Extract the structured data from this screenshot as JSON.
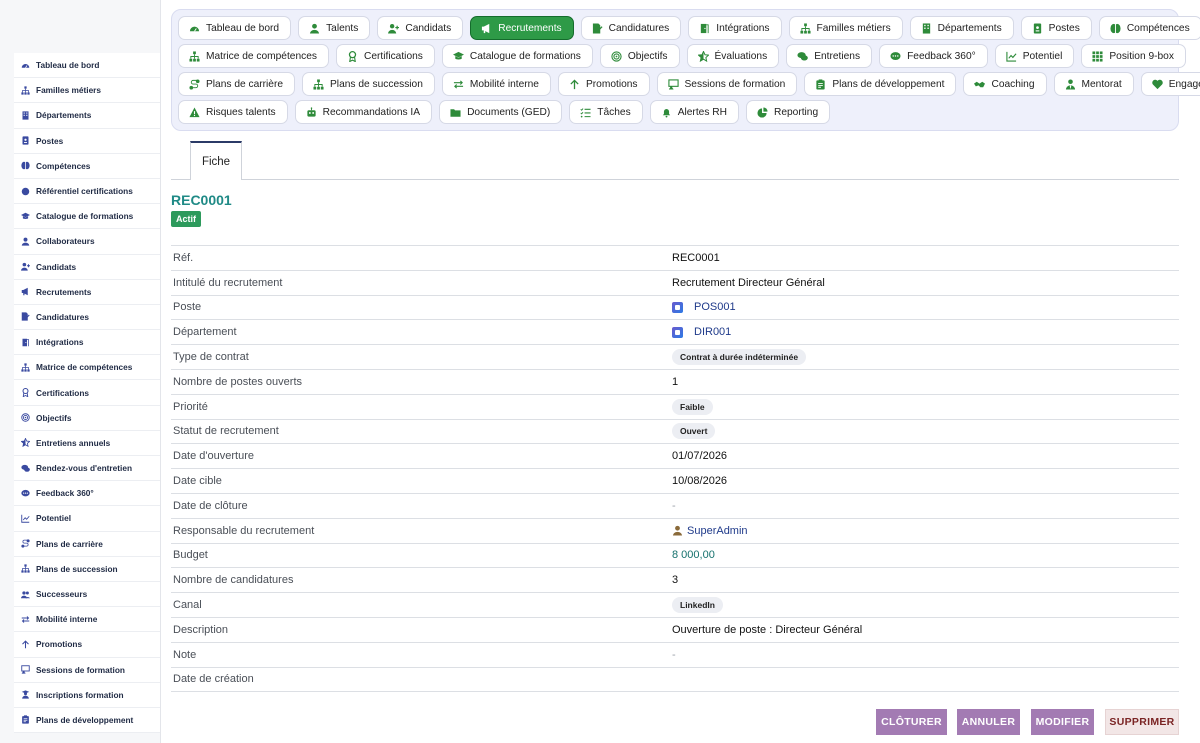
{
  "sidebar": {
    "items": [
      {
        "label": "Tableau de bord",
        "icon": "dashboard-icon"
      },
      {
        "label": "Familles métiers",
        "icon": "sitemap-icon"
      },
      {
        "label": "Départements",
        "icon": "building-icon"
      },
      {
        "label": "Postes",
        "icon": "id-badge-icon"
      },
      {
        "label": "Compétences",
        "icon": "brain-icon"
      },
      {
        "label": "Référentiel certifications",
        "icon": "certificate-icon"
      },
      {
        "label": "Catalogue de formations",
        "icon": "graduation-cap-icon"
      },
      {
        "label": "Collaborateurs",
        "icon": "user-icon"
      },
      {
        "label": "Candidats",
        "icon": "user-plus-icon"
      },
      {
        "label": "Recrutements",
        "icon": "bullhorn-icon"
      },
      {
        "label": "Candidatures",
        "icon": "file-signature-icon"
      },
      {
        "label": "Intégrations",
        "icon": "door-open-icon"
      },
      {
        "label": "Matrice de compétences",
        "icon": "sitemap-icon"
      },
      {
        "label": "Certifications",
        "icon": "award-icon"
      },
      {
        "label": "Objectifs",
        "icon": "bullseye-icon"
      },
      {
        "label": "Entretiens annuels",
        "icon": "star-half-icon"
      },
      {
        "label": "Rendez-vous d'entretien",
        "icon": "comments-icon"
      },
      {
        "label": "Feedback 360°",
        "icon": "comment-dots-icon"
      },
      {
        "label": "Potentiel",
        "icon": "chart-line-icon"
      },
      {
        "label": "Plans de carrière",
        "icon": "route-icon"
      },
      {
        "label": "Plans de succession",
        "icon": "sitemap-icon"
      },
      {
        "label": "Successeurs",
        "icon": "users-icon"
      },
      {
        "label": "Mobilité interne",
        "icon": "exchange-icon"
      },
      {
        "label": "Promotions",
        "icon": "arrow-up-icon"
      },
      {
        "label": "Sessions de formation",
        "icon": "chalkboard-icon"
      },
      {
        "label": "Inscriptions formation",
        "icon": "user-graduate-icon"
      },
      {
        "label": "Plans de développement",
        "icon": "clipboard-icon"
      }
    ]
  },
  "topnav": {
    "rows": [
      [
        {
          "label": "Tableau de bord",
          "icon": "dashboard-icon"
        },
        {
          "label": "Talents",
          "icon": "user-icon"
        },
        {
          "label": "Candidats",
          "icon": "user-plus-icon"
        },
        {
          "label": "Recrutements",
          "icon": "bullhorn-icon",
          "active": true
        },
        {
          "label": "Candidatures",
          "icon": "file-signature-icon"
        },
        {
          "label": "Intégrations",
          "icon": "door-open-icon"
        },
        {
          "label": "Familles métiers",
          "icon": "sitemap-icon"
        },
        {
          "label": "Départements",
          "icon": "building-icon"
        },
        {
          "label": "Postes",
          "icon": "id-badge-icon"
        },
        {
          "label": "Compétences",
          "icon": "brain-icon"
        }
      ],
      [
        {
          "label": "Matrice de compétences",
          "icon": "sitemap-icon"
        },
        {
          "label": "Certifications",
          "icon": "award-icon"
        },
        {
          "label": "Catalogue de formations",
          "icon": "graduation-cap-icon"
        },
        {
          "label": "Objectifs",
          "icon": "bullseye-icon"
        },
        {
          "label": "Évaluations",
          "icon": "star-half-icon"
        },
        {
          "label": "Entretiens",
          "icon": "comments-icon"
        },
        {
          "label": "Feedback 360°",
          "icon": "comment-dots-icon"
        },
        {
          "label": "Potentiel",
          "icon": "chart-line-icon"
        },
        {
          "label": "Position 9-box",
          "icon": "grid-icon"
        }
      ],
      [
        {
          "label": "Plans de carrière",
          "icon": "route-icon"
        },
        {
          "label": "Plans de succession",
          "icon": "sitemap-icon"
        },
        {
          "label": "Mobilité interne",
          "icon": "exchange-icon"
        },
        {
          "label": "Promotions",
          "icon": "arrow-up-icon"
        },
        {
          "label": "Sessions de formation",
          "icon": "chalkboard-icon"
        },
        {
          "label": "Plans de développement",
          "icon": "clipboard-icon"
        },
        {
          "label": "Coaching",
          "icon": "handshake-icon"
        },
        {
          "label": "Mentorat",
          "icon": "user-tie-icon"
        },
        {
          "label": "Engagement",
          "icon": "heart-icon"
        }
      ],
      [
        {
          "label": "Risques talents",
          "icon": "warning-icon"
        },
        {
          "label": "Recommandations IA",
          "icon": "robot-icon"
        },
        {
          "label": "Documents (GED)",
          "icon": "folder-icon"
        },
        {
          "label": "Tâches",
          "icon": "tasks-icon"
        },
        {
          "label": "Alertes RH",
          "icon": "bell-icon"
        },
        {
          "label": "Reporting",
          "icon": "chart-pie-icon"
        }
      ]
    ]
  },
  "tabs": {
    "fiche": "Fiche"
  },
  "record": {
    "title": "REC0001",
    "status_badge": "Actif"
  },
  "details": [
    {
      "label": "Réf.",
      "value": "REC0001",
      "type": "text"
    },
    {
      "label": "Intitulé du recrutement",
      "value": "Recrutement Directeur Général",
      "type": "text"
    },
    {
      "label": "Poste",
      "value": "POS001",
      "type": "link-object"
    },
    {
      "label": "Département",
      "value": "DIR001",
      "type": "link-object"
    },
    {
      "label": "Type de contrat",
      "value": "Contrat à durée indéterminée",
      "type": "pill"
    },
    {
      "label": "Nombre de postes ouverts",
      "value": "1",
      "type": "text"
    },
    {
      "label": "Priorité",
      "value": "Faible",
      "type": "pill"
    },
    {
      "label": "Statut de recrutement",
      "value": "Ouvert",
      "type": "pill"
    },
    {
      "label": "Date d'ouverture",
      "value": "01/07/2026",
      "type": "text"
    },
    {
      "label": "Date cible",
      "value": "10/08/2026",
      "type": "text"
    },
    {
      "label": "Date de clôture",
      "value": "-",
      "type": "muted"
    },
    {
      "label": "Responsable du recrutement",
      "value": "SuperAdmin",
      "type": "link-user"
    },
    {
      "label": "Budget",
      "value": "8 000,00",
      "type": "teal"
    },
    {
      "label": "Nombre de candidatures",
      "value": "3",
      "type": "text"
    },
    {
      "label": "Canal",
      "value": "LinkedIn",
      "type": "pill"
    },
    {
      "label": "Description",
      "value": "Ouverture de poste : Directeur Général",
      "type": "text"
    },
    {
      "label": "Note",
      "value": "-",
      "type": "muted"
    },
    {
      "label": "Date de création",
      "value": "",
      "type": "text"
    }
  ],
  "actions": {
    "cloturer": "CLÔTURER",
    "annuler": "ANNULER",
    "modifier": "MODIFIER",
    "supprimer": "SUPPRIMER"
  },
  "colors": {
    "active_nav": "#2e9a47",
    "record_title": "#1f8a86",
    "status_badge": "#2d9a5c",
    "action_button": "#a37bb3"
  }
}
